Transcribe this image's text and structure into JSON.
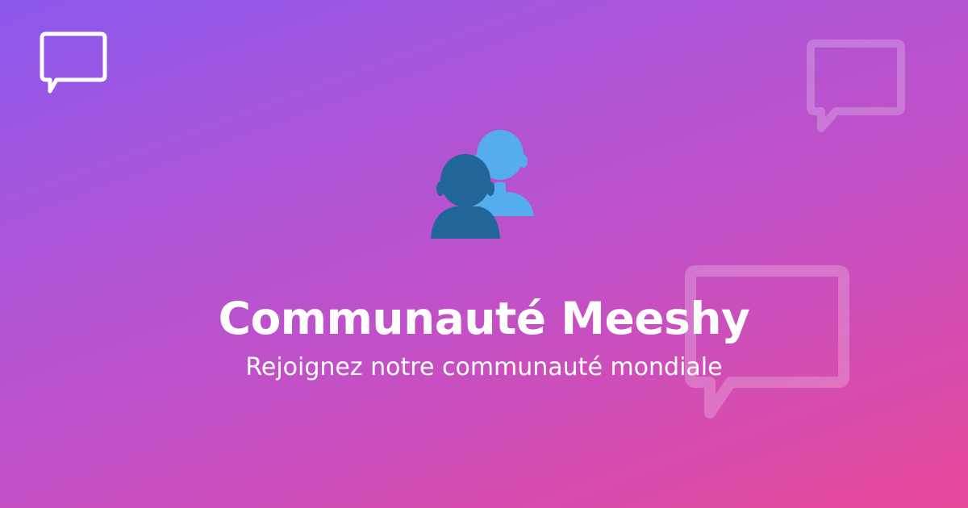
{
  "brand": {
    "logo_icon": "chat-bubble-icon"
  },
  "hero": {
    "icon": "busts-in-silhouette-icon",
    "title": "Communauté Meeshy",
    "subtitle": "Rejoignez notre communauté mondiale"
  },
  "decorations": {
    "bubble_icons": [
      "chat-bubble-icon",
      "chat-bubble-icon"
    ]
  },
  "colors": {
    "gradient_start": "#8a58ec",
    "gradient_mid": "#c350c6",
    "gradient_end": "#e84a9a",
    "text": "#ffffff",
    "person_back": "#55acee",
    "person_front": "#226699"
  }
}
